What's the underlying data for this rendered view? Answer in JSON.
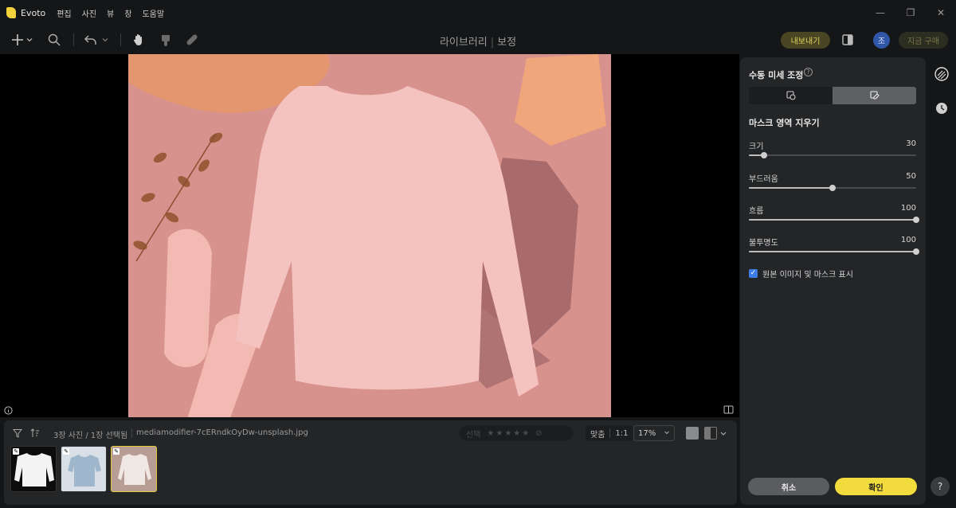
{
  "titlebar": {
    "app_name": "Evoto",
    "menu": [
      "편집",
      "사진",
      "뷰",
      "창",
      "도움말"
    ],
    "minimize": "—",
    "restore": "❐",
    "close": "✕"
  },
  "toolbar": {
    "crumb_library": "라이브러리",
    "crumb_divider": "|",
    "crumb_edit": "보정",
    "export_label": "내보내기",
    "avatar_initial": "조",
    "buy_label": "지금 구매"
  },
  "filmstrip": {
    "count_text": "3장 사진 / 1장 선택됨",
    "filename": "mediamodifier-7cERndkOyDw-unsplash.jpg",
    "rating_label": "선택",
    "stars": "★★★★★",
    "zoom_fit": "맞춤",
    "zoom_one": "1:1",
    "zoom_percent": "17%"
  },
  "panel": {
    "title": "수동 미세 조정",
    "section_title": "마스크 영역 지우기",
    "sliders": [
      {
        "label": "크기",
        "value": "30",
        "fraction": 0.09
      },
      {
        "label": "부드러움",
        "value": "50",
        "fraction": 0.5
      },
      {
        "label": "흐름",
        "value": "100",
        "fraction": 1.0
      },
      {
        "label": "불투명도",
        "value": "100",
        "fraction": 1.0
      }
    ],
    "checkbox_label": "원본 이미지 및 마스크 표시",
    "cancel_label": "취소",
    "confirm_label": "확인"
  },
  "colors": {
    "accent_yellow": "#f1db3d",
    "mask_overlay": "#d7928d",
    "panel_bg": "#242527",
    "checkbox_blue": "#3d7de8"
  }
}
